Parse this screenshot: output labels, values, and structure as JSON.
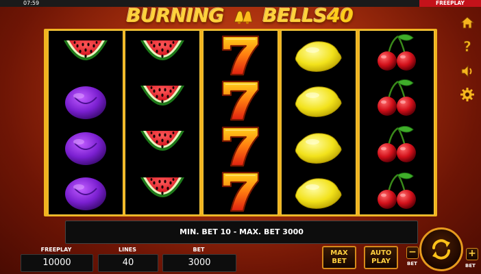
{
  "status_bar": {
    "time": "07:59",
    "mode": "FREEPLAY"
  },
  "game": {
    "title_main": "BURNING",
    "title_second": "BELLS",
    "title_number": "40"
  },
  "reels": [
    [
      "watermelon",
      "plum",
      "plum",
      "plum"
    ],
    [
      "watermelon",
      "watermelon",
      "watermelon",
      "watermelon"
    ],
    [
      "seven",
      "seven",
      "seven",
      "seven"
    ],
    [
      "lemon",
      "lemon",
      "lemon",
      "lemon"
    ],
    [
      "cherry",
      "cherry",
      "cherry",
      "cherry"
    ]
  ],
  "info_message": "MIN. BET 10 - MAX. BET 3000",
  "panels": {
    "freeplay": {
      "label": "FREEPLAY",
      "value": "10000"
    },
    "lines": {
      "label": "LINES",
      "value": "40"
    },
    "bet": {
      "label": "BET",
      "value": "3000"
    }
  },
  "buttons": {
    "max_bet_line1": "MAX",
    "max_bet_line2": "BET",
    "auto_play_line1": "AUTO",
    "auto_play_line2": "PLAY",
    "bet_minus": "−",
    "bet_plus": "+",
    "bet_minus_caption": "BET",
    "bet_plus_caption": "BET"
  },
  "side_menu": [
    "home-icon",
    "help-icon",
    "sound-icon",
    "settings-icon"
  ],
  "colors": {
    "accent": "#f0b420",
    "badge": "#c4121a",
    "title": "#ffd23c"
  }
}
